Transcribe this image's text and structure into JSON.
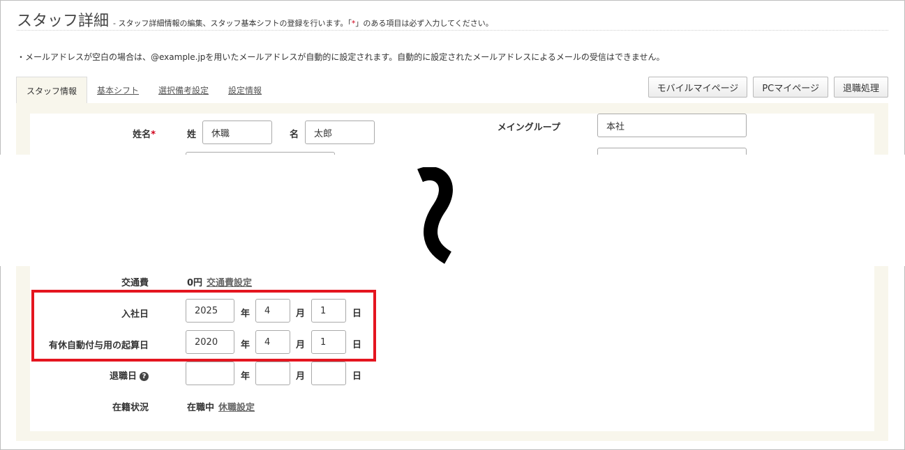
{
  "header": {
    "title": "スタッフ詳細",
    "subtitle_before": "- スタッフ詳細情報の編集、スタッフ基本シフトの登録を行います。「",
    "subtitle_req": "*",
    "subtitle_after": "」のある項目は必ず入力してください。"
  },
  "notice": "・メールアドレスが空白の場合は、@example.jpを用いたメールアドレスが自動的に設定されます。自動的に設定されたメールアドレスによるメールの受信はできません。",
  "tabs": [
    {
      "label": "スタッフ情報"
    },
    {
      "label": "基本シフト"
    },
    {
      "label": "選択備考設定"
    },
    {
      "label": "設定情報"
    }
  ],
  "buttons": {
    "mobile": "モバイルマイページ",
    "pc": "PCマイページ",
    "retire": "退職処理"
  },
  "name_section": {
    "label": "姓名",
    "required_mark": "*",
    "sei_label": "姓",
    "sei_value": "休職",
    "mei_label": "名",
    "mei_value": "太郎"
  },
  "main_group": {
    "label": "メイングループ",
    "value": "本社"
  },
  "transport": {
    "label": "交通費",
    "value": "0円",
    "link": "交通費設定"
  },
  "date_units": {
    "year": "年",
    "month": "月",
    "day": "日"
  },
  "hire_date": {
    "label": "入社日",
    "year": "2025",
    "month": "4",
    "day": "1"
  },
  "paid_leave_start": {
    "label": "有休自動付与用の起算日",
    "year": "2020",
    "month": "4",
    "day": "1"
  },
  "retire_date": {
    "label": "退職日",
    "help_icon": "?",
    "year": "",
    "month": "",
    "day": ""
  },
  "status": {
    "label": "在籍状況",
    "value": "在職中",
    "link": "休職設定"
  },
  "colors": {
    "highlight": "#e4151f",
    "panel_bg": "#f8f6ec",
    "required": "#d0021b"
  }
}
